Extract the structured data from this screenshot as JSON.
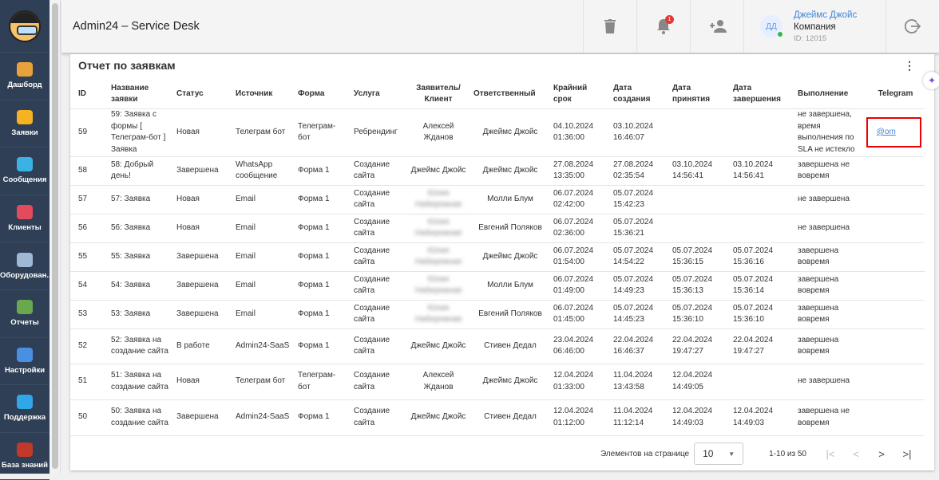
{
  "sidebar": {
    "items": [
      {
        "label": "Дашборд",
        "icon": "dashboard-icon",
        "color": "#e9a23b"
      },
      {
        "label": "Заявки",
        "icon": "megaphone-icon",
        "color": "#f5b221"
      },
      {
        "label": "Сообщения",
        "icon": "chat-icon",
        "color": "#39b3e6"
      },
      {
        "label": "Клиенты",
        "icon": "clients-icon",
        "color": "#e34b5a"
      },
      {
        "label": "Оборудован...",
        "icon": "equipment-icon",
        "color": "#9fb8d6"
      },
      {
        "label": "Отчеты",
        "icon": "reports-icon",
        "color": "#6aa84f"
      },
      {
        "label": "Настройки",
        "icon": "gear-icon",
        "color": "#4a90e2"
      },
      {
        "label": "Поддержка",
        "icon": "help-icon",
        "color": "#2fa7e8"
      },
      {
        "label": "База знаний",
        "icon": "book-icon",
        "color": "#c0392b"
      }
    ]
  },
  "header": {
    "title": "Admin24 – Service Desk",
    "notifications": "1",
    "user": {
      "initials": "ДД",
      "name": "Джеймс Джойс",
      "company": "Компания",
      "id": "ID: 12015"
    }
  },
  "report": {
    "title": "Отчет по заявкам",
    "columns": [
      "ID",
      "Название заявки",
      "Статус",
      "Источник",
      "Форма",
      "Услуга",
      "Заявитель/ Клиент",
      "Ответственный",
      "Крайний срок",
      "Дата создания",
      "Дата принятия",
      "Дата завершения",
      "Выполнение",
      "Telegram"
    ],
    "rows": [
      [
        "59",
        "59: Заявка с формы [ Телеграм-бот ] Заявка",
        "Новая",
        "Телеграм бот",
        "Телеграм-бот",
        "Ребрендинг",
        "Алексей Жданов",
        "Джеймс Джойс",
        "04.10.2024 01:36:00",
        "03.10.2024 16:46:07",
        "",
        "",
        "не завершена, время выполнения по SLA не истекло",
        "@om"
      ],
      [
        "58",
        "58: Добрый день!",
        "Завершена",
        "WhatsApp сообщение",
        "Форма 1",
        "Создание сайта",
        "Джеймс Джойс",
        "Джеймс Джойс",
        "27.08.2024 13:35:00",
        "27.08.2024 02:35:54",
        "03.10.2024 14:56:41",
        "03.10.2024 14:56:41",
        "завершена не вовремя",
        ""
      ],
      [
        "57",
        "57: Заявка",
        "Новая",
        "Email",
        "Форма 1",
        "Создание сайта",
        "Юлия Набережная",
        "Молли Блум",
        "06.07.2024 02:42:00",
        "05.07.2024 15:42:23",
        "",
        "",
        "не завершена",
        ""
      ],
      [
        "56",
        "56: Заявка",
        "Новая",
        "Email",
        "Форма 1",
        "Создание сайта",
        "Юлия Набережная",
        "Евгений Поляков",
        "06.07.2024 02:36:00",
        "05.07.2024 15:36:21",
        "",
        "",
        "не завершена",
        ""
      ],
      [
        "55",
        "55: Заявка",
        "Завершена",
        "Email",
        "Форма 1",
        "Создание сайта",
        "Юлия Набережная",
        "Джеймс Джойс",
        "06.07.2024 01:54:00",
        "05.07.2024 14:54:22",
        "05.07.2024 15:36:15",
        "05.07.2024 15:36:16",
        "завершена вовремя",
        ""
      ],
      [
        "54",
        "54: Заявка",
        "Завершена",
        "Email",
        "Форма 1",
        "Создание сайта",
        "Юлия Набережная",
        "Молли Блум",
        "06.07.2024 01:49:00",
        "05.07.2024 14:49:23",
        "05.07.2024 15:36:13",
        "05.07.2024 15:36:14",
        "завершена вовремя",
        ""
      ],
      [
        "53",
        "53: Заявка",
        "Завершена",
        "Email",
        "Форма 1",
        "Создание сайта",
        "Юлия Набережная",
        "Евгений Поляков",
        "06.07.2024 01:45:00",
        "05.07.2024 14:45:23",
        "05.07.2024 15:36:10",
        "05.07.2024 15:36:10",
        "завершена вовремя",
        ""
      ],
      [
        "52",
        "52: Заявка на создание сайта",
        "В работе",
        "Admin24-SaaS",
        "Форма 1",
        "Создание сайта",
        "Джеймс Джойс",
        "Стивен Дедал",
        "23.04.2024 06:46:00",
        "22.04.2024 16:46:37",
        "22.04.2024 19:47:27",
        "22.04.2024 19:47:27",
        "завершена вовремя",
        ""
      ],
      [
        "51",
        "51: Заявка на создание сайта",
        "Новая",
        "Телеграм бот",
        "Телеграм-бот",
        "Создание сайта",
        "Алексей Жданов",
        "Джеймс Джойс",
        "12.04.2024 01:33:00",
        "11.04.2024 13:43:58",
        "12.04.2024 14:49:05",
        "",
        "не завершена",
        ""
      ],
      [
        "50",
        "50: Заявка на создание сайта",
        "Завершена",
        "Admin24-SaaS",
        "Форма 1",
        "Создание сайта",
        "Джеймс Джойс",
        "Стивен Дедал",
        "12.04.2024 01:12:00",
        "11.04.2024 11:12:14",
        "12.04.2024 14:49:03",
        "12.04.2024 14:49:03",
        "завершена не вовремя",
        ""
      ]
    ]
  },
  "pager": {
    "label": "Элементов на странице",
    "per_page": "10",
    "range": "1-10 из 50"
  }
}
